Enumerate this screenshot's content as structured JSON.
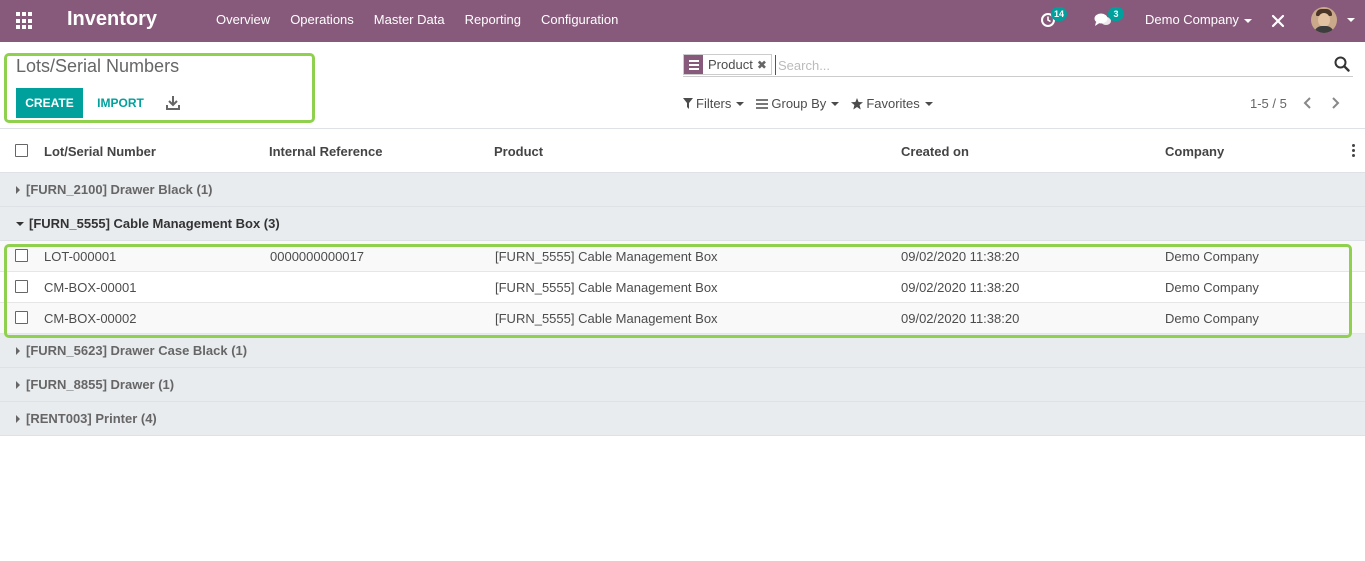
{
  "app": {
    "name": "Inventory",
    "menu": [
      "Overview",
      "Operations",
      "Master Data",
      "Reporting",
      "Configuration"
    ],
    "activity_count": "14",
    "message_count": "3",
    "company": "Demo Company"
  },
  "colors": {
    "navbar": "#875a7b",
    "primary": "#00a09d",
    "highlight": "#8fd14f"
  },
  "control_panel": {
    "breadcrumb": "Lots/Serial Numbers",
    "create_label": "CREATE",
    "import_label": "IMPORT",
    "search_facet": "Product",
    "search_placeholder": "Search...",
    "filters_label": "Filters",
    "groupby_label": "Group By",
    "favorites_label": "Favorites",
    "pager": "1-5 / 5"
  },
  "list": {
    "columns": [
      "Lot/Serial Number",
      "Internal Reference",
      "Product",
      "Created on",
      "Company"
    ],
    "groups": [
      {
        "label": "[FURN_2100] Drawer Black (1)",
        "expanded": false,
        "rows": []
      },
      {
        "label": "[FURN_5555] Cable Management Box (3)",
        "expanded": true,
        "rows": [
          {
            "lot": "LOT-000001",
            "ref": "0000000000017",
            "product": "[FURN_5555] Cable Management Box",
            "created": "09/02/2020 11:38:20",
            "company": "Demo Company"
          },
          {
            "lot": "CM-BOX-00001",
            "ref": "",
            "product": "[FURN_5555] Cable Management Box",
            "created": "09/02/2020 11:38:20",
            "company": "Demo Company"
          },
          {
            "lot": "CM-BOX-00002",
            "ref": "",
            "product": "[FURN_5555] Cable Management Box",
            "created": "09/02/2020 11:38:20",
            "company": "Demo Company"
          }
        ]
      },
      {
        "label": "[FURN_5623] Drawer Case Black (1)",
        "expanded": false,
        "rows": []
      },
      {
        "label": "[FURN_8855] Drawer (1)",
        "expanded": false,
        "rows": []
      },
      {
        "label": "[RENT003] Printer (4)",
        "expanded": false,
        "rows": []
      }
    ]
  }
}
